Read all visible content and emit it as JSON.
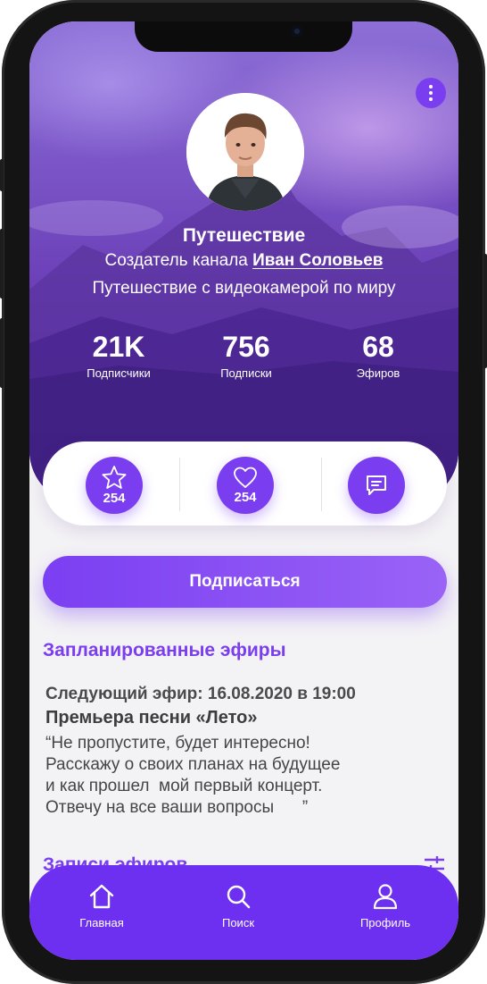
{
  "channel": {
    "title": "Путешествие",
    "creator_prefix": "Создатель канала",
    "owner": "Иван Соловьев",
    "description": "Путешествие с видеокамерой по миру"
  },
  "stats": [
    {
      "value": "21K",
      "label": "Подписчики"
    },
    {
      "value": "756",
      "label": "Подписки"
    },
    {
      "value": "68",
      "label": "Эфиров"
    }
  ],
  "reactions": {
    "favorites": {
      "icon": "star-icon",
      "count": "254"
    },
    "likes": {
      "icon": "heart-icon",
      "count": "254"
    },
    "comments": {
      "icon": "chat-icon"
    }
  },
  "subscribe_label": "Подписаться",
  "scheduled": {
    "title": "Запланированные эфиры",
    "next": "Следующий эфир: 16.08.2020 в 19:00",
    "name": "Премьера песни «Лето»",
    "quote": "“Не пропустите, будет интересно!\nРасскажу о своих планах на будущее\nи как прошел  мой первый концерт.\nОтвечу на все ваши вопросы      ”"
  },
  "records": {
    "title": "Записи эфиров"
  },
  "nav": [
    {
      "icon": "home-icon",
      "label": "Главная"
    },
    {
      "icon": "search-icon",
      "label": "Поиск"
    },
    {
      "icon": "profile-icon",
      "label": "Профиль"
    }
  ],
  "colors": {
    "accent": "#7a3ef0",
    "tabbar": "#6d2ff0",
    "background": "#f3f2f5"
  }
}
